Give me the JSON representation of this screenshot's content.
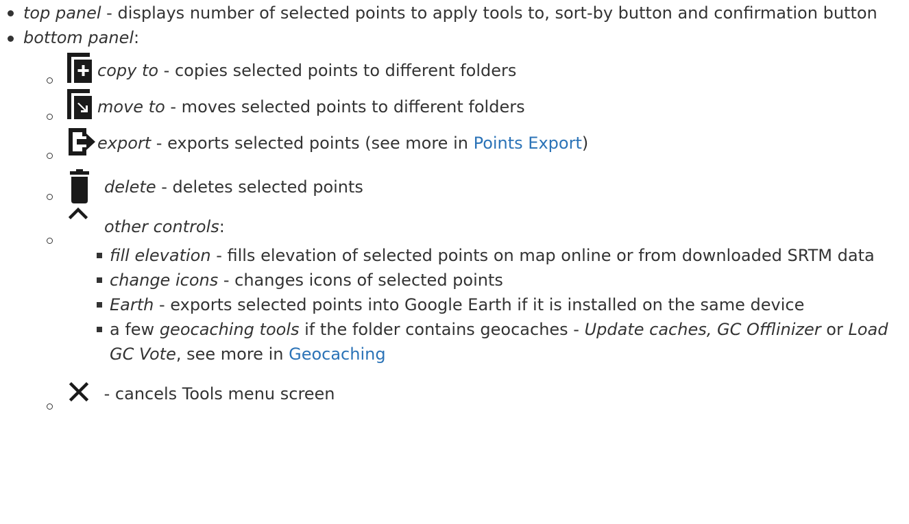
{
  "top_panel": {
    "term": "top panel",
    "description": " - displays number of selected points to apply tools to, sort-by button and confirmation button"
  },
  "bottom_panel": {
    "term": "bottom panel",
    "colon": ":",
    "tools": [
      {
        "icon": "copy-to-icon",
        "term": "copy to",
        "description": " - copies selected points to different folders"
      },
      {
        "icon": "move-to-icon",
        "term": "move to",
        "description": " - moves selected points to different folders"
      },
      {
        "icon": "export-icon",
        "term": "export",
        "description": " - exports selected points (see more in ",
        "link": "Points Export",
        "after": ")"
      },
      {
        "icon": "delete-icon",
        "term": "delete",
        "description": " - deletes selected points"
      },
      {
        "icon": "chevron-up-icon",
        "term": "other controls",
        "description": ":"
      },
      {
        "icon": "close-icon",
        "description": " - cancels Tools menu screen"
      }
    ],
    "other_controls": [
      {
        "term": "fill elevation",
        "description": " - fills elevation of selected points on map online or from downloaded SRTM data"
      },
      {
        "term": "change icons",
        "description": " - changes icons of selected points"
      },
      {
        "term": "Earth",
        "description": " - exports selected points into Google Earth if it is installed on the same device"
      },
      {
        "prefix": "a few ",
        "term": "geocaching tools",
        "middle": " if the folder contains geocaches - ",
        "term2": "Update caches, GC Offlinizer",
        "or": " or ",
        "term3": "Load GC Vote",
        "middle2": ", see more in ",
        "link": "Geocaching"
      }
    ]
  },
  "colors": {
    "text": "#333333",
    "link": "#2b73b7",
    "icon": "#1a1a1a"
  }
}
